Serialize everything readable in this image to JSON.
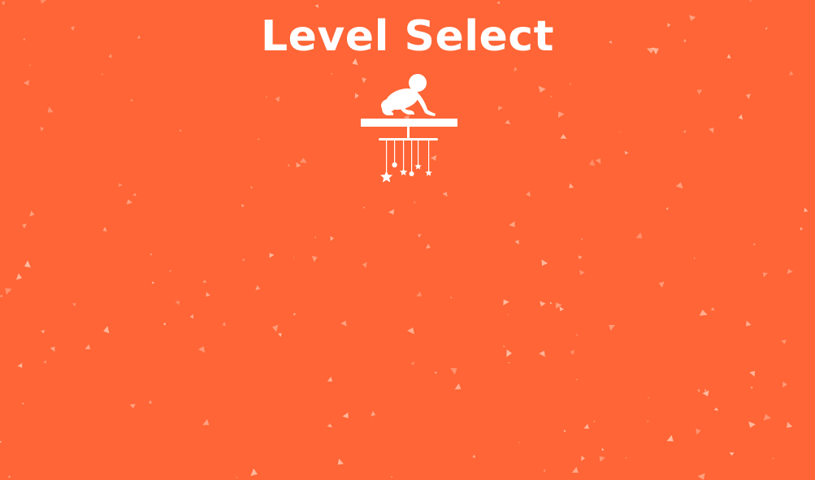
{
  "screen": {
    "title": "Level Select",
    "background_color": "#FF6536",
    "foreground_color": "#FFFFFF",
    "speckle_color": "#FFD2BE"
  },
  "levels": [
    {
      "icon": "baby-crib-mobile-icon",
      "label": ""
    }
  ]
}
